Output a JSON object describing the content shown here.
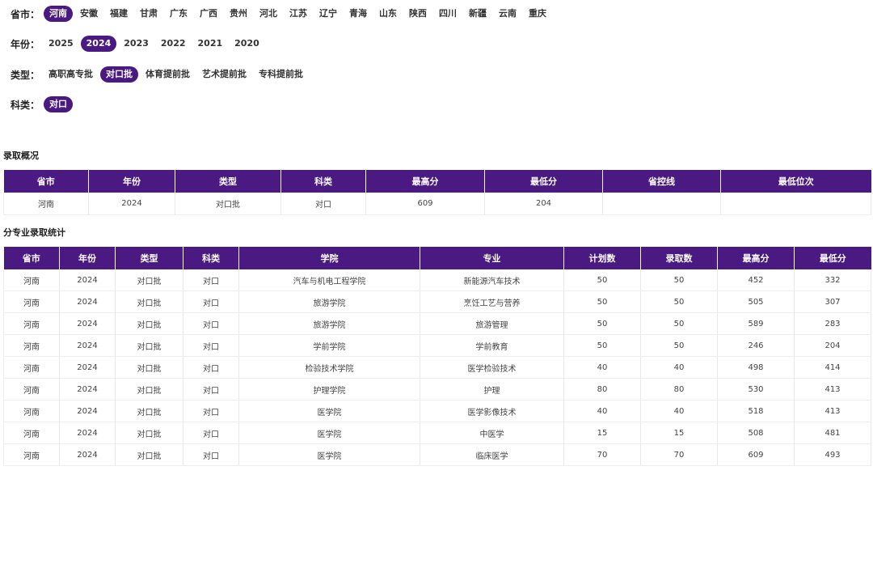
{
  "filters": {
    "province": {
      "label": "省市：",
      "options": [
        "河南",
        "安徽",
        "福建",
        "甘肃",
        "广东",
        "广西",
        "贵州",
        "河北",
        "江苏",
        "辽宁",
        "青海",
        "山东",
        "陕西",
        "四川",
        "新疆",
        "云南",
        "重庆"
      ],
      "selected": "河南"
    },
    "year": {
      "label": "年份：",
      "options": [
        "2025",
        "2024",
        "2023",
        "2022",
        "2021",
        "2020"
      ],
      "selected": "2024"
    },
    "type": {
      "label": "类型：",
      "options": [
        "高职高专批",
        "对口批",
        "体育提前批",
        "艺术提前批",
        "专科提前批"
      ],
      "selected": "对口批"
    },
    "subject": {
      "label": "科类：",
      "options": [
        "对口"
      ],
      "selected": "对口"
    }
  },
  "summary": {
    "title": "录取概况",
    "headers": [
      "省市",
      "年份",
      "类型",
      "科类",
      "最高分",
      "最低分",
      "省控线",
      "最低位次"
    ],
    "rows": [
      [
        "河南",
        "2024",
        "对口批",
        "对口",
        "609",
        "204",
        "",
        ""
      ]
    ]
  },
  "detail": {
    "title": "分专业录取统计",
    "headers": [
      "省市",
      "年份",
      "类型",
      "科类",
      "学院",
      "专业",
      "计划数",
      "录取数",
      "最高分",
      "最低分"
    ],
    "rows": [
      [
        "河南",
        "2024",
        "对口批",
        "对口",
        "汽车与机电工程学院",
        "新能源汽车技术",
        "50",
        "50",
        "452",
        "332"
      ],
      [
        "河南",
        "2024",
        "对口批",
        "对口",
        "旅游学院",
        "烹饪工艺与营养",
        "50",
        "50",
        "505",
        "307"
      ],
      [
        "河南",
        "2024",
        "对口批",
        "对口",
        "旅游学院",
        "旅游管理",
        "50",
        "50",
        "589",
        "283"
      ],
      [
        "河南",
        "2024",
        "对口批",
        "对口",
        "学前学院",
        "学前教育",
        "50",
        "50",
        "246",
        "204"
      ],
      [
        "河南",
        "2024",
        "对口批",
        "对口",
        "检验技术学院",
        "医学检验技术",
        "40",
        "40",
        "498",
        "414"
      ],
      [
        "河南",
        "2024",
        "对口批",
        "对口",
        "护理学院",
        "护理",
        "80",
        "80",
        "530",
        "413"
      ],
      [
        "河南",
        "2024",
        "对口批",
        "对口",
        "医学院",
        "医学影像技术",
        "40",
        "40",
        "518",
        "413"
      ],
      [
        "河南",
        "2024",
        "对口批",
        "对口",
        "医学院",
        "中医学",
        "15",
        "15",
        "508",
        "481"
      ],
      [
        "河南",
        "2024",
        "对口批",
        "对口",
        "医学院",
        "临床医学",
        "70",
        "70",
        "609",
        "493"
      ]
    ]
  },
  "colors": {
    "accent": "#4a1a82",
    "header_text": "#ffffff"
  }
}
